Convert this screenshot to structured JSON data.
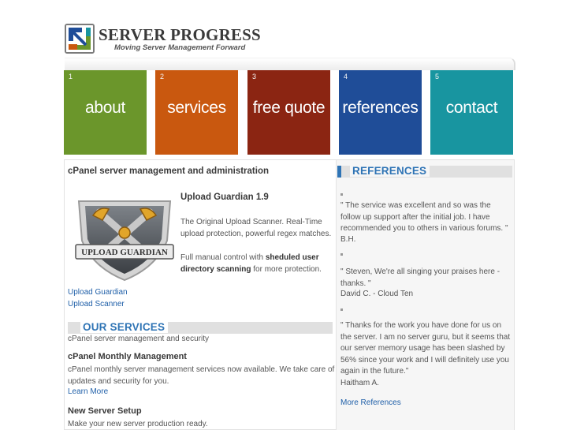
{
  "brand": {
    "name": "SERVER PROGRESS",
    "tagline": "Moving Server Management Forward"
  },
  "nav": [
    {
      "number": "1",
      "label": "about",
      "color": "#6b962b"
    },
    {
      "number": "2",
      "label": "services",
      "color": "#c9580f"
    },
    {
      "number": "3",
      "label": "free quote",
      "color": "#8b2512"
    },
    {
      "number": "4",
      "label": "references",
      "color": "#1f4d98"
    },
    {
      "number": "5",
      "label": "contact",
      "color": "#1895a0"
    }
  ],
  "main": {
    "heading": "cPanel server management and administration",
    "product": {
      "title": "Upload Guardian 1.9",
      "description": "The Original Upload Scanner. Real-Time upload protection, powerful regex matches.",
      "control_prefix": "Full manual control with ",
      "control_bold": "sheduled user directory scanning",
      "control_suffix": " for more protection.",
      "badge_text": "UPLOAD GUARDIAN"
    },
    "links": [
      "Upload Guardian",
      "Upload Scanner"
    ]
  },
  "services": {
    "title": "OUR SERVICES",
    "subtitle": "cPanel server management and security",
    "items": [
      {
        "title": "cPanel Monthly Management",
        "text": "cPanel monthly server management services now available. We take care of updates and security for you.",
        "more": "Learn More"
      },
      {
        "title": "New Server Setup",
        "text": "Make your new server production ready."
      }
    ]
  },
  "references": {
    "title": "REFERENCES",
    "items": [
      {
        "quote": "\" The service was excellent and so was the follow up support after the initial job. I have recommended you to others in various forums. \"",
        "author": "B.H."
      },
      {
        "quote": "\" Steven, We're all singing your praises here - thanks. \"",
        "author": "David C. - Cloud Ten"
      },
      {
        "quote": "\" Thanks for the work you have done for us on the server. I am no server guru, but it seems that our server memory usage has been slashed by 56% since your work and I will definitely use you again in the future.\"",
        "author": "Haitham A."
      }
    ],
    "more": "More References"
  },
  "colors": {
    "accent_blue": "#2f74b5",
    "link": "#1f5fa8"
  }
}
